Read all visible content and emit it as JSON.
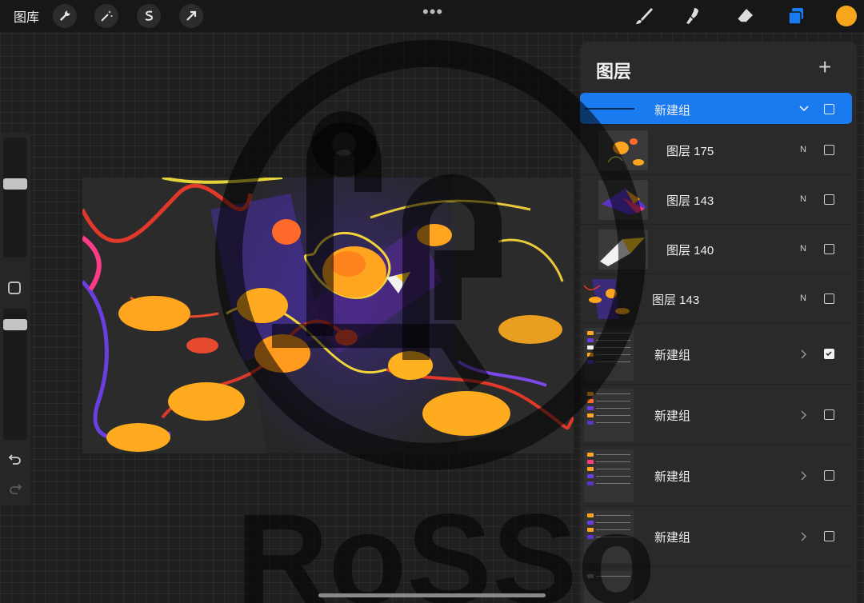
{
  "topbar": {
    "gallery_label": "图库",
    "more_label": "•••",
    "tools_left": [
      "wrench-icon",
      "magic-wand-icon",
      "selection-s-icon",
      "transform-arrow-icon"
    ],
    "tools_right": [
      "brush-icon",
      "smudge-icon",
      "eraser-icon",
      "layers-icon"
    ],
    "active_color": "#f7a51c",
    "accent": "#1a7af0"
  },
  "sidebar": {
    "brush_size_level": 0.62,
    "opacity_level": 0.55
  },
  "layers_panel": {
    "title": "图层",
    "add_label": "+",
    "group_header": {
      "name": "新建组",
      "expanded": true,
      "visible": false
    },
    "layers": [
      {
        "name": "图层 175",
        "blend": "N",
        "visible": false
      },
      {
        "name": "图层 143",
        "blend": "N",
        "visible": false
      },
      {
        "name": "图层 140",
        "blend": "N",
        "visible": false
      },
      {
        "name": "图层 143",
        "blend": "N",
        "visible": false
      }
    ],
    "groups": [
      {
        "name": "新建组",
        "visible": true
      },
      {
        "name": "新建组",
        "visible": false
      },
      {
        "name": "新建组",
        "visible": false
      },
      {
        "name": "新建组",
        "visible": false
      }
    ]
  },
  "watermark": {
    "text": "RoSSo"
  }
}
